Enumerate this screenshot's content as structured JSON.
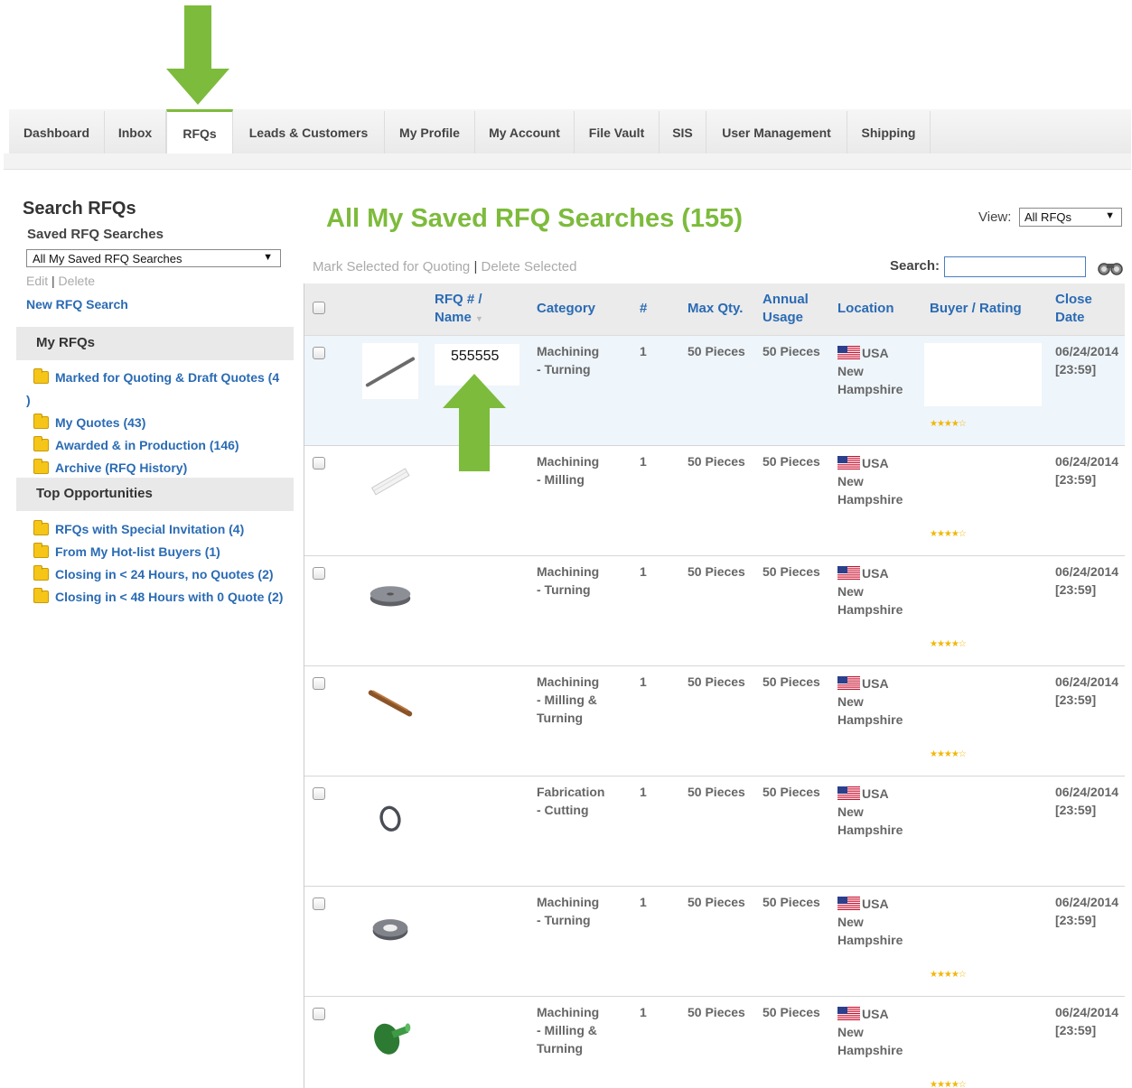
{
  "tabs": [
    {
      "label": "Dashboard"
    },
    {
      "label": "Inbox"
    },
    {
      "label": "RFQs"
    },
    {
      "label": "Leads & Customers"
    },
    {
      "label": "My Profile"
    },
    {
      "label": "My Account"
    },
    {
      "label": "File Vault"
    },
    {
      "label": "SIS"
    },
    {
      "label": "User Management"
    },
    {
      "label": "Shipping"
    }
  ],
  "sidebar": {
    "title": "Search RFQs",
    "saved_label": "Saved RFQ Searches",
    "saved_select": "All My Saved RFQ Searches",
    "edit": "Edit",
    "separator": "|",
    "delete": "Delete",
    "new_search": "New RFQ Search",
    "my_rfqs_header": "My RFQs",
    "my_rfqs": [
      {
        "label": "Marked for Quoting & Draft Quotes (4"
      },
      {
        "label": ")"
      },
      {
        "label": "My Quotes (43)"
      },
      {
        "label": "Awarded & in Production (146)"
      },
      {
        "label": "Archive (RFQ History)"
      }
    ],
    "top_header": "Top Opportunities",
    "top": [
      {
        "label": "RFQs with Special Invitation (4)"
      },
      {
        "label": "From My Hot-list Buyers (1)"
      },
      {
        "label": "Closing in < 24 Hours, no Quotes (2)"
      },
      {
        "label": "Closing in < 48 Hours with 0 Quote (2)"
      }
    ]
  },
  "main": {
    "title": "All My Saved RFQ Searches (155)",
    "view_label": "View:",
    "view_value": "All RFQs",
    "mark_selected": "Mark Selected for Quoting",
    "action_sep": "|",
    "delete_selected": "Delete Selected",
    "search_label": "Search:",
    "search_value": ""
  },
  "table": {
    "headers": {
      "rfq_line1": "RFQ # /",
      "rfq_line2": "Name",
      "category": "Category",
      "num": "#",
      "max_qty": "Max Qty.",
      "annual_line1": "Annual",
      "annual_line2": "Usage",
      "location": "Location",
      "buyer": "Buyer / Rating",
      "close_line1": "Close",
      "close_line2": "Date"
    },
    "rows": [
      {
        "name": "555555",
        "cat1": "Machining",
        "cat2": "- Turning",
        "cat3": "",
        "num": "1",
        "max_qty": "50 Pieces",
        "annual": "50 Pieces",
        "country": "USA",
        "state1": "New",
        "state2": "Hampshire",
        "date": "06/24/2014",
        "time": "[23:59]",
        "rating": "★★★★☆"
      },
      {
        "name": "",
        "cat1": "Machining",
        "cat2": "- Milling",
        "cat3": "",
        "num": "1",
        "max_qty": "50 Pieces",
        "annual": "50 Pieces",
        "country": "USA",
        "state1": "New",
        "state2": "Hampshire",
        "date": "06/24/2014",
        "time": "[23:59]",
        "rating": "★★★★☆"
      },
      {
        "name": "",
        "cat1": "Machining",
        "cat2": "- Turning",
        "cat3": "",
        "num": "1",
        "max_qty": "50 Pieces",
        "annual": "50 Pieces",
        "country": "USA",
        "state1": "New",
        "state2": "Hampshire",
        "date": "06/24/2014",
        "time": "[23:59]",
        "rating": "★★★★☆"
      },
      {
        "name": "",
        "cat1": "Machining",
        "cat2": "- Milling &",
        "cat3": "Turning",
        "num": "1",
        "max_qty": "50 Pieces",
        "annual": "50 Pieces",
        "country": "USA",
        "state1": "New",
        "state2": "Hampshire",
        "date": "06/24/2014",
        "time": "[23:59]",
        "rating": "★★★★☆"
      },
      {
        "name": "",
        "cat1": "Fabrication",
        "cat2": "- Cutting",
        "cat3": "",
        "num": "1",
        "max_qty": "50 Pieces",
        "annual": "50 Pieces",
        "country": "USA",
        "state1": "New",
        "state2": "Hampshire",
        "date": "06/24/2014",
        "time": "[23:59]",
        "rating": ""
      },
      {
        "name": "",
        "cat1": "Machining",
        "cat2": "- Turning",
        "cat3": "",
        "num": "1",
        "max_qty": "50 Pieces",
        "annual": "50 Pieces",
        "country": "USA",
        "state1": "New",
        "state2": "Hampshire",
        "date": "06/24/2014",
        "time": "[23:59]",
        "rating": "★★★★☆"
      },
      {
        "name": "",
        "cat1": "Machining",
        "cat2": "- Milling &",
        "cat3": "Turning",
        "num": "1",
        "max_qty": "50 Pieces",
        "annual": "50 Pieces",
        "country": "USA",
        "state1": "New",
        "state2": "Hampshire",
        "date": "06/24/2014",
        "time": "[23:59]",
        "rating": "★★★★☆"
      }
    ]
  },
  "colors": {
    "accent": "#7dbb3c",
    "link": "#2a6bb4"
  }
}
